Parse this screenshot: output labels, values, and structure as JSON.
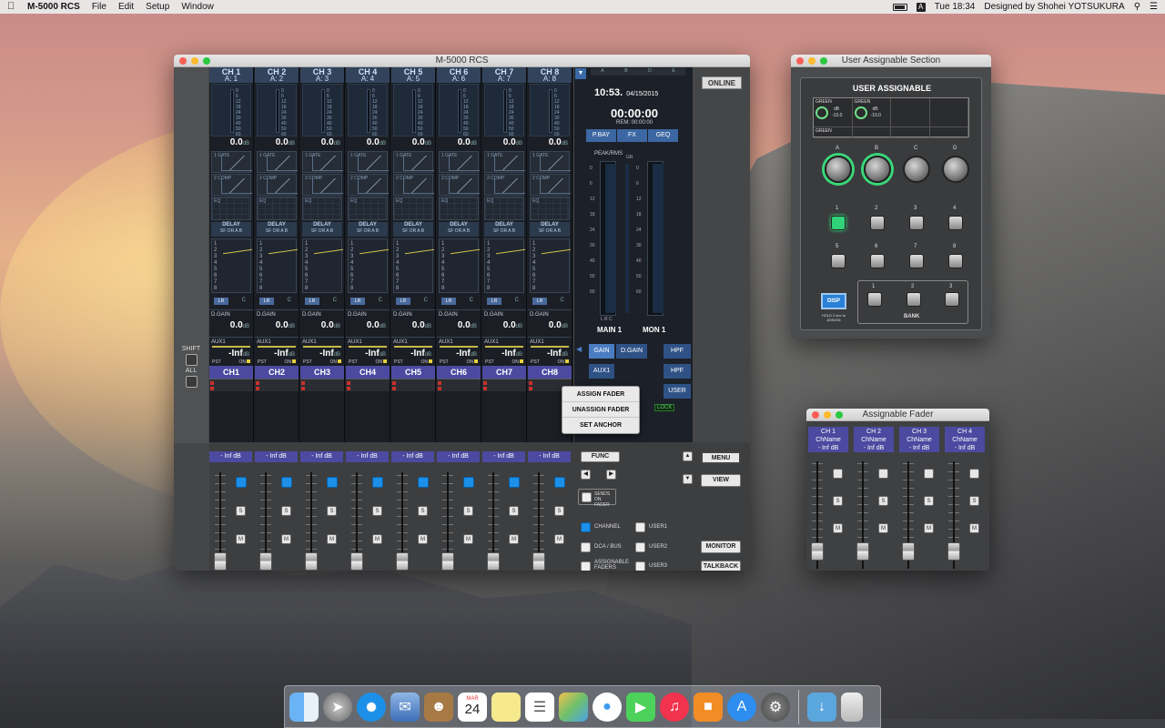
{
  "menubar": {
    "app_name": "M-5000 RCS",
    "items": [
      "File",
      "Edit",
      "Setup",
      "Window"
    ],
    "clock": "Tue 18:34",
    "designer": "Designed by Shohei YOTSUKURA",
    "input_source": "A"
  },
  "main_window": {
    "title": "M-5000 RCS",
    "online_label": "ONLINE",
    "shift_label": "SHIFT",
    "all_label": "ALL",
    "channels": [
      {
        "head": "CH 1",
        "sub": "A: 1",
        "gain": "0.0",
        "dgain": "0.0",
        "aux": "-Inf",
        "name": "CH1",
        "fader": "- Inf dB"
      },
      {
        "head": "CH 2",
        "sub": "A: 2",
        "gain": "0.0",
        "dgain": "0.0",
        "aux": "-Inf",
        "name": "CH2",
        "fader": "- Inf dB"
      },
      {
        "head": "CH 3",
        "sub": "A: 3",
        "gain": "0.0",
        "dgain": "0.0",
        "aux": "-Inf",
        "name": "CH3",
        "fader": "- Inf dB"
      },
      {
        "head": "CH 4",
        "sub": "A: 4",
        "gain": "0.0",
        "dgain": "0.0",
        "aux": "-Inf",
        "name": "CH4",
        "fader": "- Inf dB"
      },
      {
        "head": "CH 5",
        "sub": "A: 5",
        "gain": "0.0",
        "dgain": "0.0",
        "aux": "-Inf",
        "name": "CH5",
        "fader": "- Inf dB"
      },
      {
        "head": "CH 6",
        "sub": "A: 6",
        "gain": "0.0",
        "dgain": "0.0",
        "aux": "-Inf",
        "name": "CH6",
        "fader": "- Inf dB"
      },
      {
        "head": "CH 7",
        "sub": "A: 7",
        "gain": "0.0",
        "dgain": "0.0",
        "aux": "-Inf",
        "name": "CH7",
        "fader": "- Inf dB"
      },
      {
        "head": "CH 8",
        "sub": "A: 8",
        "gain": "0.0",
        "dgain": "0.0",
        "aux": "-Inf",
        "name": "CH8",
        "fader": "- Inf dB"
      }
    ],
    "labels": {
      "db": "dB",
      "gate": "1 GATE",
      "comp": "2 COMP",
      "eq": "EQ",
      "delay": "DELAY",
      "delay_opts": "SF  OR  A  B",
      "lr": "LR",
      "c": "C",
      "dgain": "D.GAIN",
      "aux1": "AUX1",
      "pst": "PST",
      "on": "ON",
      "s": "S",
      "m": "M",
      "bus_numbers": [
        "1",
        "2",
        "3",
        "4",
        "5",
        "6",
        "7",
        "8"
      ],
      "meter_scale": [
        "0",
        "6",
        "12",
        "18",
        "24",
        "30",
        "40",
        "50",
        "60"
      ]
    },
    "status": {
      "time": "10:53.",
      "date": "04/15/2015",
      "timecode": "00:00:00",
      "remaining": "REM: 00:00:00",
      "ruler_marks": [
        "A",
        "B",
        "D",
        "E"
      ],
      "tabs": [
        "P.BAY",
        "FX",
        "GEQ"
      ],
      "peak_label": "PEAK/RMS",
      "gr_label": "GR",
      "lrc_label": "L R C",
      "main_label": "MAIN 1",
      "mon_label": "MON 1",
      "meter_scale": [
        "0",
        "6",
        "12",
        "18",
        "24",
        "30",
        "40",
        "50",
        "60"
      ]
    },
    "param_tabs": [
      "GAIN",
      "D.GAIN",
      "HPF",
      "AUX1",
      "HPF",
      "USER"
    ],
    "lock_label": "LOCK",
    "popup_menu": [
      "ASSIGN FADER",
      "UNASSIGN FADER",
      "SET ANCHOR"
    ],
    "controls": {
      "func": "FUNC",
      "menu": "MENU",
      "view": "VIEW",
      "sends_on_fader": "SENDS ON FADER",
      "channel": "CHANNEL",
      "dca_bus": "DCA / BUS",
      "assignable_faders": "ASSIGNABLE FADERS",
      "user1": "USER1",
      "user2": "USER2",
      "user3": "USER3",
      "monitor": "MONITOR",
      "talkback": "TALKBACK"
    }
  },
  "uas_window": {
    "title": "User Assignable Section",
    "heading": "USER ASSIGNABLE",
    "display_cells": [
      {
        "name": "GREEN",
        "unit": "dB",
        "value": "-10.0"
      },
      {
        "name": "GREEN",
        "unit": "dB",
        "value": "-10.0"
      }
    ],
    "display_bottom": "GREEN",
    "knob_labels": [
      "A",
      "B",
      "C",
      "D"
    ],
    "button_labels": [
      "1",
      "2",
      "3",
      "4",
      "5",
      "6",
      "7",
      "8"
    ],
    "disp_label": "DISP",
    "hold_text": "HOLD 2 sec to ASSIGN",
    "bank_buttons": [
      "1",
      "2",
      "3"
    ],
    "bank_label": "BANK"
  },
  "assignable_fader_window": {
    "title": "Assignable Fader",
    "strips": [
      {
        "ch": "CH 1",
        "name": "ChName",
        "value": "- Inf dB"
      },
      {
        "ch": "CH 2",
        "name": "ChName",
        "value": "- Inf dB"
      },
      {
        "ch": "CH 3",
        "name": "ChName",
        "value": "- Inf dB"
      },
      {
        "ch": "CH 4",
        "name": "ChName",
        "value": "- Inf dB"
      }
    ]
  },
  "dock": {
    "calendar_month": "MAR",
    "calendar_day": "24",
    "icons": [
      "finder-icon",
      "launchpad-icon",
      "safari-icon",
      "mail-icon",
      "contacts-icon",
      "calendar-icon",
      "notes-icon",
      "reminders-icon",
      "photos-icon",
      "messages-icon",
      "facetime-icon",
      "itunes-icon",
      "ibooks-icon",
      "app-store-icon",
      "system-preferences-icon",
      "downloads-icon",
      "trash-icon"
    ]
  }
}
